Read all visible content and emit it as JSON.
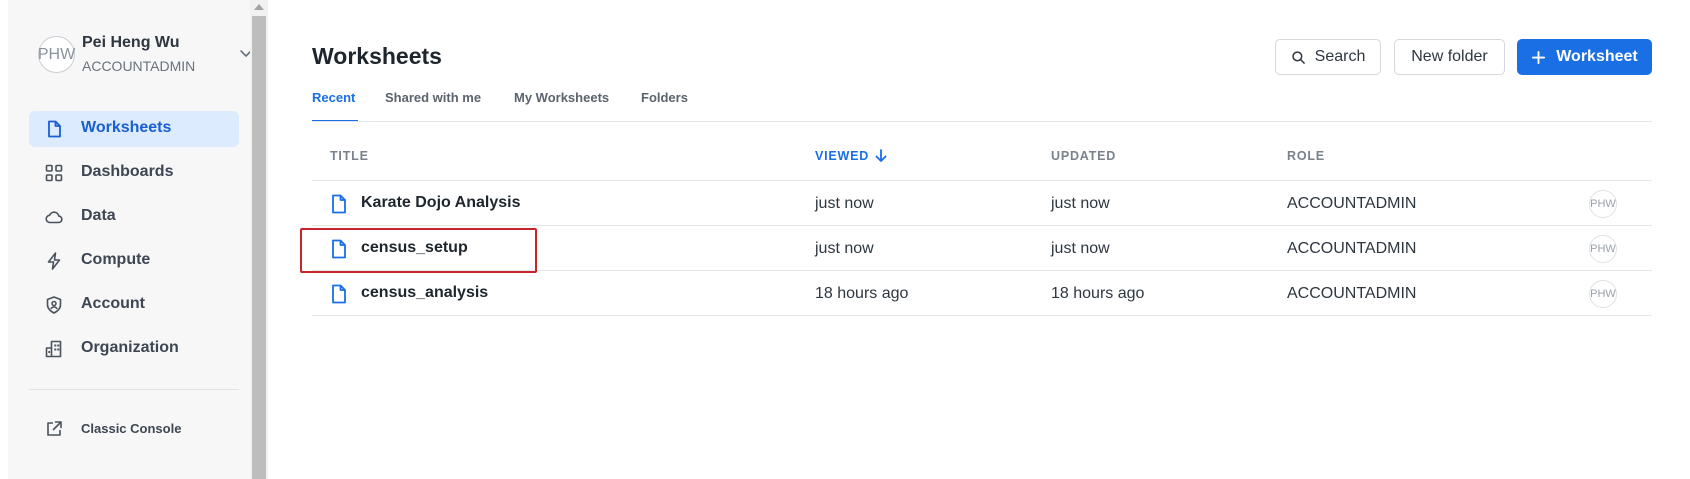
{
  "user": {
    "initials": "PHW",
    "name": "Pei Heng Wu",
    "role": "ACCOUNTADMIN"
  },
  "nav": [
    {
      "label": "Worksheets",
      "icon": "file-icon",
      "active": true
    },
    {
      "label": "Dashboards",
      "icon": "grid-icon",
      "active": false
    },
    {
      "label": "Data",
      "icon": "cloud-icon",
      "active": false
    },
    {
      "label": "Compute",
      "icon": "lightning-icon",
      "active": false
    },
    {
      "label": "Account",
      "icon": "shield-user-icon",
      "active": false
    },
    {
      "label": "Organization",
      "icon": "building-icon",
      "active": false
    }
  ],
  "classic_console": {
    "label": "Classic Console",
    "icon": "external-link-icon"
  },
  "page": {
    "title": "Worksheets"
  },
  "toolbar": {
    "search_label": "Search",
    "new_folder_label": "New folder",
    "new_worksheet_label": "Worksheet"
  },
  "tabs": [
    {
      "label": "Recent",
      "active": true
    },
    {
      "label": "Shared with me",
      "active": false
    },
    {
      "label": "My Worksheets",
      "active": false
    },
    {
      "label": "Folders",
      "active": false
    }
  ],
  "table": {
    "columns": {
      "title": "TITLE",
      "viewed": "VIEWED",
      "updated": "UPDATED",
      "role": "ROLE"
    },
    "sort": {
      "column": "viewed",
      "direction": "descending"
    },
    "rows": [
      {
        "title": "Karate Dojo Analysis",
        "viewed": "just now",
        "updated": "just now",
        "role": "ACCOUNTADMIN",
        "owner": "PHW"
      },
      {
        "title": "census_setup",
        "viewed": "just now",
        "updated": "just now",
        "role": "ACCOUNTADMIN",
        "owner": "PHW"
      },
      {
        "title": "census_analysis",
        "viewed": "18 hours ago",
        "updated": "18 hours ago",
        "role": "ACCOUNTADMIN",
        "owner": "PHW"
      }
    ]
  },
  "highlighted_row": "census_setup",
  "colors": {
    "accent": "#1a6fe5",
    "active_nav_bg": "#dcebfd",
    "highlight_border": "#c8242b",
    "sidebar_bg": "#f7f7f8"
  }
}
